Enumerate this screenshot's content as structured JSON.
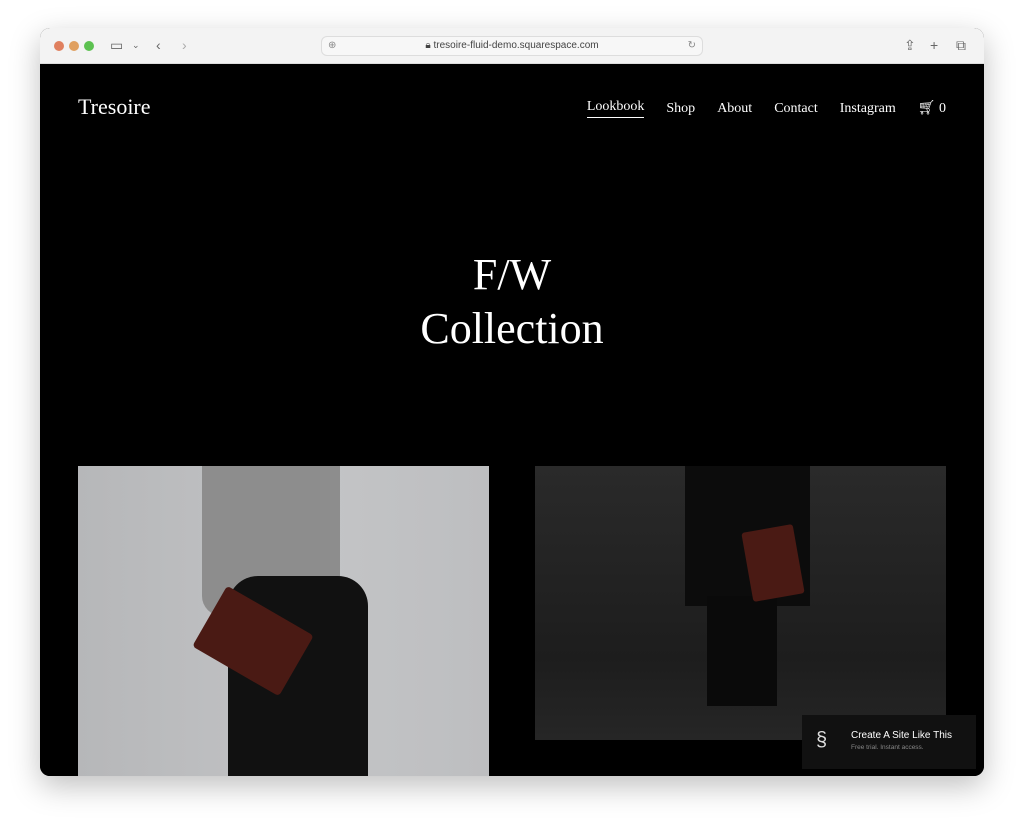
{
  "browser": {
    "url": "tresoire-fluid-demo.squarespace.com"
  },
  "site": {
    "logo": "Tresoire",
    "nav": [
      {
        "label": "Lookbook",
        "active": true
      },
      {
        "label": "Shop"
      },
      {
        "label": "About"
      },
      {
        "label": "Contact"
      },
      {
        "label": "Instagram"
      }
    ],
    "cart_count": "0",
    "hero_line1": "F/W",
    "hero_line2": "Collection"
  },
  "badge": {
    "title": "Create A Site Like This",
    "subtitle": "Free trial. Instant access."
  }
}
